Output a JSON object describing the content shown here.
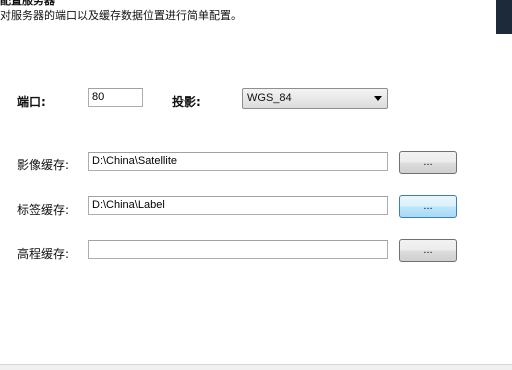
{
  "header": {
    "title": "配置服务器",
    "subtitle": "对服务器的端口以及缓存数据位置进行简单配置。"
  },
  "form": {
    "port_label": "端口:",
    "port_value": "80",
    "projection_label": "投影:",
    "projection_value": "WGS_84",
    "image_cache_label": "影像缓存:",
    "image_cache_value": "D:\\China\\Satellite",
    "label_cache_label": "标签缓存:",
    "label_cache_value": "D:\\China\\Label",
    "elevation_cache_label": "高程缓存:",
    "elevation_cache_value": ""
  },
  "buttons": {
    "browse_label": "..."
  }
}
